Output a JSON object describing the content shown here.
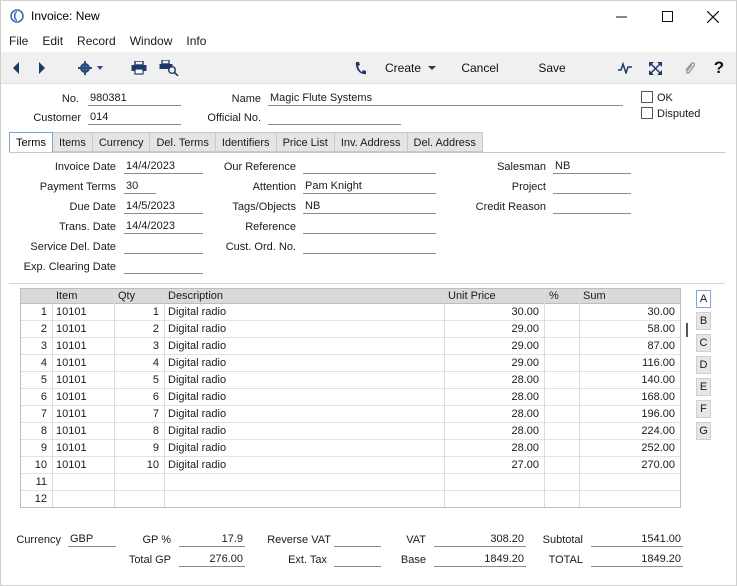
{
  "window": {
    "title": "Invoice: New"
  },
  "menu": [
    "File",
    "Edit",
    "Record",
    "Window",
    "Info"
  ],
  "toolbar": {
    "create_label": "Create",
    "cancel_label": "Cancel",
    "save_label": "Save"
  },
  "header": {
    "no_label": "No.",
    "no_value": "980381",
    "name_label": "Name",
    "name_value": "Magic Flute Systems",
    "customer_label": "Customer",
    "customer_value": "014",
    "official_label": "Official No.",
    "official_value": "",
    "ok_label": "OK",
    "disputed_label": "Disputed"
  },
  "tabs": [
    "Terms",
    "Items",
    "Currency",
    "Del. Terms",
    "Identifiers",
    "Price List",
    "Inv. Address",
    "Del. Address"
  ],
  "terms": {
    "invoice_date_label": "Invoice Date",
    "invoice_date": "14/4/2023",
    "payment_terms_label": "Payment Terms",
    "payment_terms": "30",
    "due_date_label": "Due Date",
    "due_date": "14/5/2023",
    "trans_date_label": "Trans. Date",
    "trans_date": "14/4/2023",
    "service_del_label": "Service Del. Date",
    "service_del": "",
    "exp_clearing_label": "Exp. Clearing Date",
    "exp_clearing": "",
    "our_ref_label": "Our Reference",
    "our_ref": "",
    "attention_label": "Attention",
    "attention": "Pam Knight",
    "tags_label": "Tags/Objects",
    "tags": "NB",
    "reference_label": "Reference",
    "reference": "",
    "cust_ord_label": "Cust. Ord. No.",
    "cust_ord": "",
    "salesman_label": "Salesman",
    "salesman": "NB",
    "project_label": "Project",
    "project": "",
    "credit_reason_label": "Credit Reason",
    "credit_reason": ""
  },
  "grid": {
    "headers": [
      "Item",
      "Qty",
      "Description",
      "Unit Price",
      "%",
      "Sum"
    ],
    "rows": [
      [
        "1",
        "10101",
        "1",
        "Digital radio",
        "30.00",
        "",
        "30.00"
      ],
      [
        "2",
        "10101",
        "2",
        "Digital radio",
        "29.00",
        "",
        "58.00"
      ],
      [
        "3",
        "10101",
        "3",
        "Digital radio",
        "29.00",
        "",
        "87.00"
      ],
      [
        "4",
        "10101",
        "4",
        "Digital radio",
        "29.00",
        "",
        "116.00"
      ],
      [
        "5",
        "10101",
        "5",
        "Digital radio",
        "28.00",
        "",
        "140.00"
      ],
      [
        "6",
        "10101",
        "6",
        "Digital radio",
        "28.00",
        "",
        "168.00"
      ],
      [
        "7",
        "10101",
        "7",
        "Digital radio",
        "28.00",
        "",
        "196.00"
      ],
      [
        "8",
        "10101",
        "8",
        "Digital radio",
        "28.00",
        "",
        "224.00"
      ],
      [
        "9",
        "10101",
        "9",
        "Digital radio",
        "28.00",
        "",
        "252.00"
      ],
      [
        "10",
        "10101",
        "10",
        "Digital radio",
        "27.00",
        "",
        "270.00"
      ],
      [
        "11",
        "",
        "",
        "",
        "",
        "",
        ""
      ],
      [
        "12",
        "",
        "",
        "",
        "",
        "",
        ""
      ]
    ],
    "side_tabs": [
      "A",
      "B",
      "C",
      "D",
      "E",
      "F",
      "G"
    ]
  },
  "footer": {
    "currency_label": "Currency",
    "currency": "GBP",
    "gp_pct_label": "GP %",
    "gp_pct": "17.9",
    "total_gp_label": "Total GP",
    "total_gp": "276.00",
    "reverse_vat_label": "Reverse VAT",
    "reverse_vat": "",
    "ext_tax_label": "Ext. Tax",
    "ext_tax": "",
    "vat_label": "VAT",
    "vat": "308.20",
    "base_label": "Base",
    "base": "1849.20",
    "subtotal_label": "Subtotal",
    "subtotal": "1541.00",
    "total_label": "TOTAL",
    "total": "1849.20"
  },
  "colors": {
    "active_tab_border": "#7aa7d8",
    "grid_header": "#d9d9d9"
  }
}
